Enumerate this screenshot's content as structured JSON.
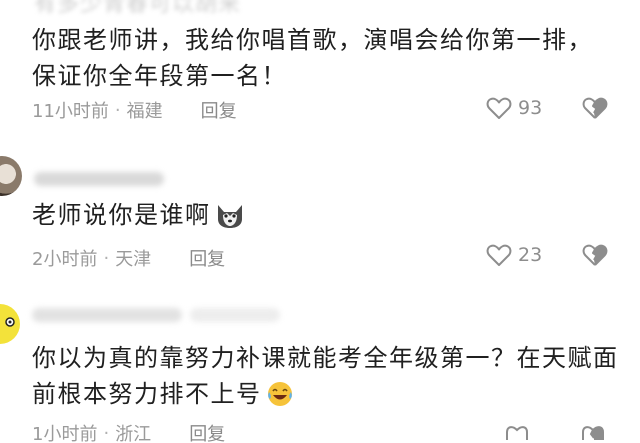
{
  "comments": [
    {
      "cut_header": "有多少青春可以胡来",
      "text": "你跟老师讲，我给你唱首歌，演唱会给你第一排，保证你全年段第一名！",
      "time": "11小时前",
      "location": "福建",
      "reply": "回复",
      "likes": "93"
    },
    {
      "text": "老师说你是谁啊",
      "emoji": "husky-emoji",
      "time": "2小时前",
      "location": "天津",
      "reply": "回复",
      "likes": "23"
    },
    {
      "text": "你以为真的靠努力补课就能考全年级第一？在天赋面前根本努力排不上号",
      "emoji": "crying-laughing-emoji",
      "time": "1小时前",
      "location": "浙江",
      "reply": "回复"
    }
  ],
  "icons": {
    "like": "heart-outline-icon",
    "dislike": "broken-heart-icon"
  },
  "colors": {
    "text": "#202020",
    "meta": "#9a9a9a",
    "icon": "#8d8d8d"
  }
}
